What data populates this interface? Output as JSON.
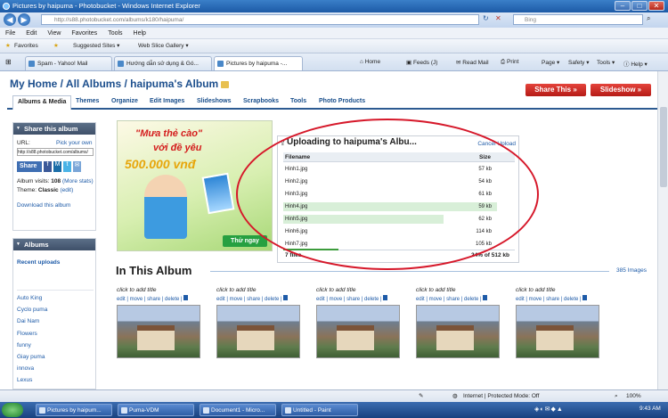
{
  "window": {
    "title": "Pictures by haipuma - Photobucket - Windows Internet Explorer"
  },
  "address": {
    "url": "http://s88.photobucket.com/albums/k180/haipuma/",
    "search_placeholder": "Bing"
  },
  "menu": [
    "File",
    "Edit",
    "View",
    "Favorites",
    "Tools",
    "Help"
  ],
  "favorites": {
    "label": "Favorites",
    "suggested": "Suggested Sites ▾",
    "webslice": "Web Slice Gallery ▾"
  },
  "tabs": [
    "Spam - Yahoo! Mail",
    "Hướng dẫn sử dụng & Gó...",
    "Pictures by haipuma -..."
  ],
  "tools": {
    "home": "Home",
    "feeds": "Feeds (J)",
    "read_mail": "Read Mail",
    "print": "Print",
    "page": "Page",
    "safety": "Safety",
    "tools": "Tools",
    "help": "Help"
  },
  "photobucket": {
    "breadcrumb": "My Home / All Albums / haipuma's Album",
    "share_this_btn": "Share This »",
    "slideshow_btn": "Slideshow »",
    "nav_tabs": [
      "Albums & Media",
      "Themes",
      "Organize",
      "Edit Images",
      "Slideshows",
      "Scrapbooks",
      "Tools",
      "Photo Products"
    ],
    "share_box": {
      "title": "Share this album",
      "url_label": "URL:",
      "pick_own": "Pick your own",
      "url_value": "http://s88.photobucket.com/albums/",
      "share_btn": "Share",
      "visits_label": "Album visits:",
      "visits": "108",
      "more_stats": "(More stats)",
      "theme_label": "Theme:",
      "theme": "Classic",
      "edit": "(edit)",
      "download": "Download this album"
    },
    "albums_box": {
      "title": "Albums",
      "recent": "Recent uploads",
      "items": [
        "Auto King",
        "Cyclo puma",
        "Dai Nam",
        "Flowers",
        "funny",
        "Giay puma",
        "innova",
        "Lexus"
      ]
    },
    "banner": {
      "line1": "\"Mưa thẻ cào\"",
      "line2": "với đề yêu",
      "amount": "500.000 vnđ",
      "cta": "Thử ngay"
    },
    "upload_panel": {
      "title": "Uploading to haipuma's Albu...",
      "cancel": "Cancel Upload",
      "col_filename": "Filename",
      "col_size": "Size",
      "files": [
        {
          "name": "Hinh1.jpg",
          "size": "57 kb",
          "progress": 0
        },
        {
          "name": "Hinh2.jpg",
          "size": "54 kb",
          "progress": 0
        },
        {
          "name": "Hinh3.jpg",
          "size": "61 kb",
          "progress": 0
        },
        {
          "name": "Hinh4.jpg",
          "size": "59 kb",
          "progress": 1
        },
        {
          "name": "Hinh5.jpg",
          "size": "62 kb",
          "progress": 0.75
        },
        {
          "name": "Hinh6.jpg",
          "size": "114 kb",
          "progress": 0
        },
        {
          "name": "Hinh7.jpg",
          "size": "105 kb",
          "progress": 0
        }
      ],
      "summary_files": "7 files",
      "summary_progress": "24% of 512 kb",
      "overall_progress": 0.24
    },
    "album": {
      "heading": "In This Album",
      "count": "385 Images",
      "thumbs": [
        {
          "title": "click to add title",
          "actions": "edit | move | share | delete |"
        },
        {
          "title": "click to add title",
          "actions": "edit | move | share | delete |"
        },
        {
          "title": "click to add title",
          "actions": "edit | move | share | delete |"
        },
        {
          "title": "click to add title",
          "actions": "edit | move | share | delete |"
        },
        {
          "title": "click to add title",
          "actions": "edit | move | share | delete |"
        }
      ]
    }
  },
  "status": {
    "zone": "Internet | Protected Mode: Off",
    "zoom": "100%"
  },
  "taskbar": {
    "items": [
      "Pictures by haipum...",
      "Puma-VDM",
      "Document1 - Micro...",
      "Untitled - Paint"
    ],
    "clock": "9:43 AM"
  },
  "colors": {
    "accent": "#1d4f8d",
    "red": "#d6182a",
    "progress": "#3c9c3c"
  }
}
